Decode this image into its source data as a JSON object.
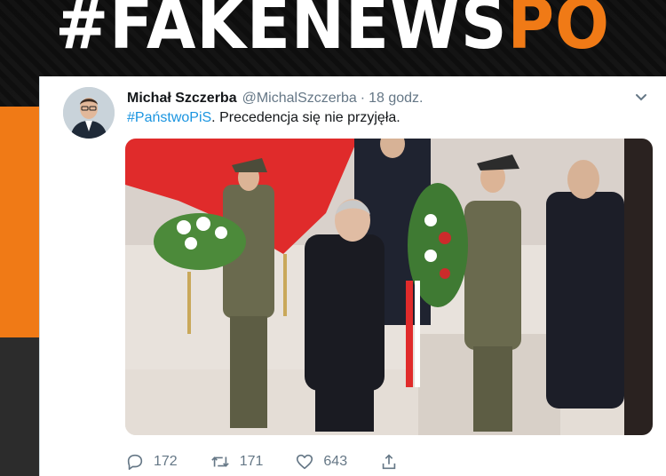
{
  "banner": {
    "text_main": "#FAKENEWS",
    "text_accent": "PO"
  },
  "tweet": {
    "author_name": "Michał Szczerba",
    "author_handle": "@MichalSzczerba",
    "separator": "·",
    "time": "18 godz.",
    "hashtag": "#PaństwoPiS",
    "text": ". Precedencja się nie przyjęła.",
    "reply_count": "172",
    "retweet_count": "171",
    "like_count": "643"
  },
  "colors": {
    "accent_orange": "#f07a16",
    "link_blue": "#1b95e0",
    "text_dark": "#14171a",
    "text_muted": "#657786"
  },
  "icons": {
    "reply": "reply-icon",
    "retweet": "retweet-icon",
    "like": "like-icon",
    "share": "share-icon",
    "menu": "chevron-down-icon"
  }
}
